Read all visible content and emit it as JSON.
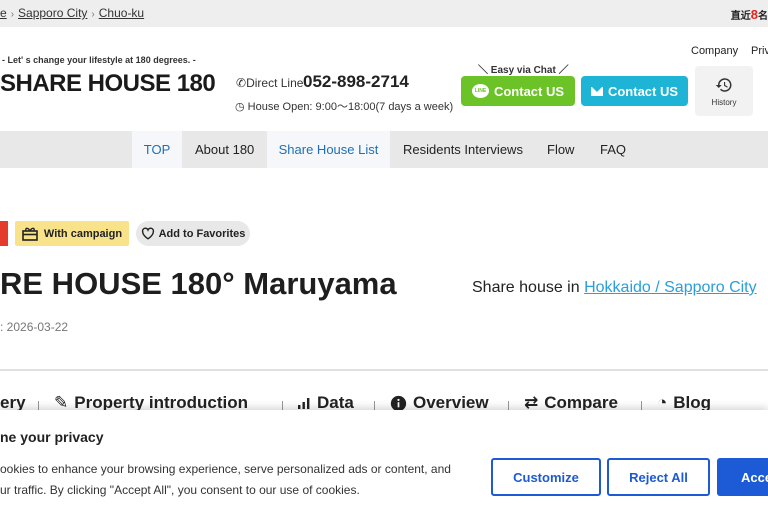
{
  "breadcrumb": {
    "home_fragment": "e",
    "city": "Sapporo City",
    "ward": "Chuo-ku",
    "separator": "›"
  },
  "corner": {
    "prefix": "直近",
    "number": "8",
    "suffix": "名"
  },
  "header": {
    "tagline": "- Let' s change your lifestyle at 180 degrees. -",
    "logo": "SHARE HOUSE 180",
    "phone_label": "Direct Line",
    "phone_number": "052-898-2714",
    "open_hours": "House Open: 9:00～18:00(7 days a week)",
    "chat_label": "＼ Easy via Chat ／",
    "line_badge": "LINE",
    "line_button": "Contact US",
    "mail_button": "Contact US",
    "company_link": "Company",
    "privacy_link": "Priv",
    "history_label": "History"
  },
  "nav": {
    "items": [
      "TOP",
      "About 180",
      "Share House List",
      "Residents Interviews",
      "Flow",
      "FAQ"
    ],
    "active": "Share House List"
  },
  "property": {
    "campaign_badge": "With campaign",
    "favorite_button": "Add to Favorites",
    "title": "RE HOUSE 180° Maruyama",
    "date": ": 2026-03-22",
    "location_prefix": "Share house in",
    "location_link": "Hokkaido / Sapporo City"
  },
  "section_tabs": [
    "ery",
    "Property introduction",
    "Data",
    "Overview",
    "Compare",
    "Blog"
  ],
  "cookie": {
    "title": "ne your privacy",
    "line1": "ookies to enhance your browsing experience, serve personalized ads or content, and",
    "line2": "ur traffic. By clicking \"Accept All\", you consent to our use of cookies.",
    "customize": "Customize",
    "reject": "Reject All",
    "accept": "Acce"
  },
  "colors": {
    "line_green": "#6cc328",
    "mail_blue": "#1eb4d6",
    "nav_active_text": "#1e6fb8",
    "campaign_yellow": "#f8e38a",
    "cookie_blue": "#1c5ad6",
    "link_blue": "#2a9fd8"
  }
}
